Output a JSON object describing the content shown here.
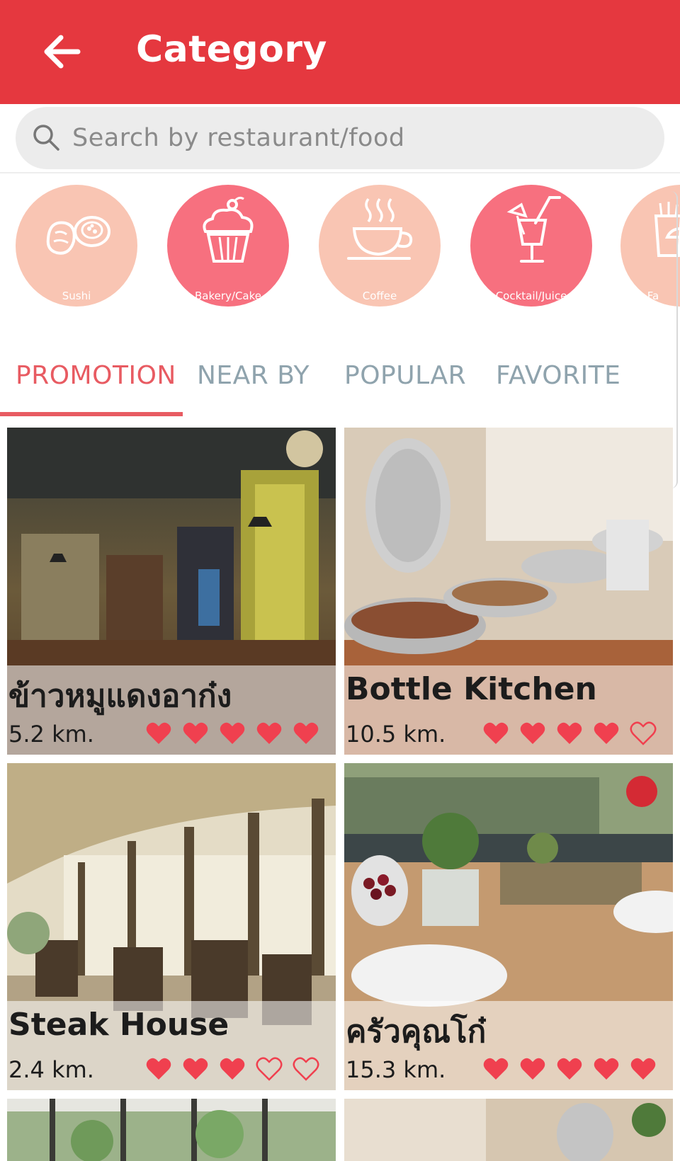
{
  "appbar": {
    "title": "Category",
    "back_icon": "arrow-left-icon"
  },
  "search": {
    "placeholder": "Search by restaurant/food",
    "value": "",
    "icon": "search-icon"
  },
  "categories": [
    {
      "label": "Sushi",
      "icon": "sushi-icon",
      "color": "#f9c5b3"
    },
    {
      "label": "Bakery/Cake",
      "icon": "cupcake-icon",
      "color": "#f7707f"
    },
    {
      "label": "Coffee",
      "icon": "coffee-cup-icon",
      "color": "#f9c5b3"
    },
    {
      "label": "Cocktail/Juice",
      "icon": "cocktail-icon",
      "color": "#f7707f"
    },
    {
      "label": "Fa",
      "icon": "fast-food-icon",
      "color": "#f9c5b3"
    }
  ],
  "tabs": [
    {
      "label": "PROMOTION",
      "active": true
    },
    {
      "label": "NEAR BY",
      "active": false
    },
    {
      "label": "POPULAR",
      "active": false
    },
    {
      "label": "FAVORITE",
      "active": false
    }
  ],
  "restaurants": [
    {
      "name": "ข้าวหมูแดงอาก๋ง",
      "distance": "5.2 km.",
      "rating": 5,
      "max_rating": 5
    },
    {
      "name": "Bottle Kitchen",
      "distance": "10.5 km.",
      "rating": 4,
      "max_rating": 5
    },
    {
      "name": "Steak House",
      "distance": "2.4 km.",
      "rating": 3,
      "max_rating": 5
    },
    {
      "name": "ครัวคุณโก๋",
      "distance": "15.3 km.",
      "rating": 5,
      "max_rating": 5
    }
  ],
  "colors": {
    "primary": "#e5383f",
    "accent": "#e85b62",
    "heart": "#f0404f",
    "tab_inactive": "#8fa3ad"
  }
}
